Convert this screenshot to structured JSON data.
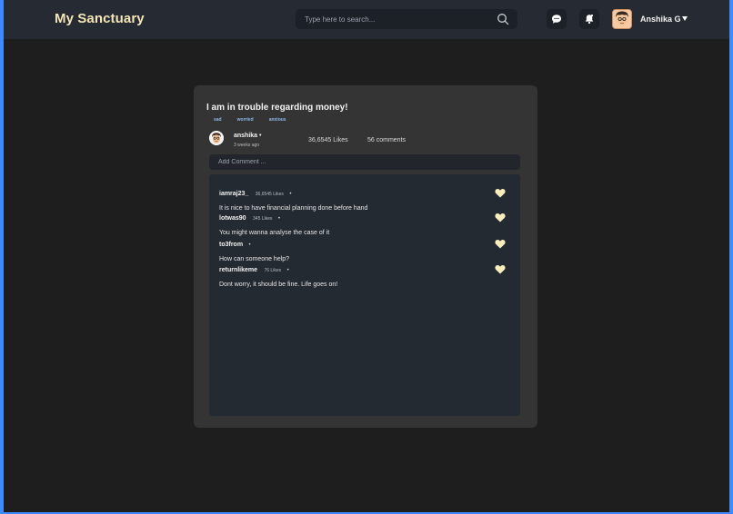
{
  "header": {
    "brand": "My Sanctuary",
    "search_placeholder": "Type here to search...",
    "username": "Anshika G"
  },
  "post": {
    "title": "I am in trouble regarding money!",
    "tags": [
      "sad",
      "worried",
      "anxious"
    ],
    "author": "anshika",
    "time": "3 weeks ago",
    "likes": "36,6545 Likes",
    "comments": "56 comments",
    "add_comment_placeholder": "Add Comment ..."
  },
  "comments": [
    {
      "user": "iamraj23_",
      "likes": "36,6545 Likes",
      "text": "It is nice to have financial planning done before hand"
    },
    {
      "user": "lotwas90",
      "likes": "345 Likes",
      "text": "You might wanna analyse the case of it"
    },
    {
      "user": "to3from",
      "likes": "",
      "text": "How can someone help?"
    },
    {
      "user": "returnlikeme",
      "likes": "76 Likes",
      "text": "Dont worry, it should be fine. Life goes on!"
    }
  ],
  "colors": {
    "accent": "#f5e6b8",
    "heart": "#f7eebc",
    "tag": "#8fb6e6",
    "frame": "#3d8bff"
  }
}
